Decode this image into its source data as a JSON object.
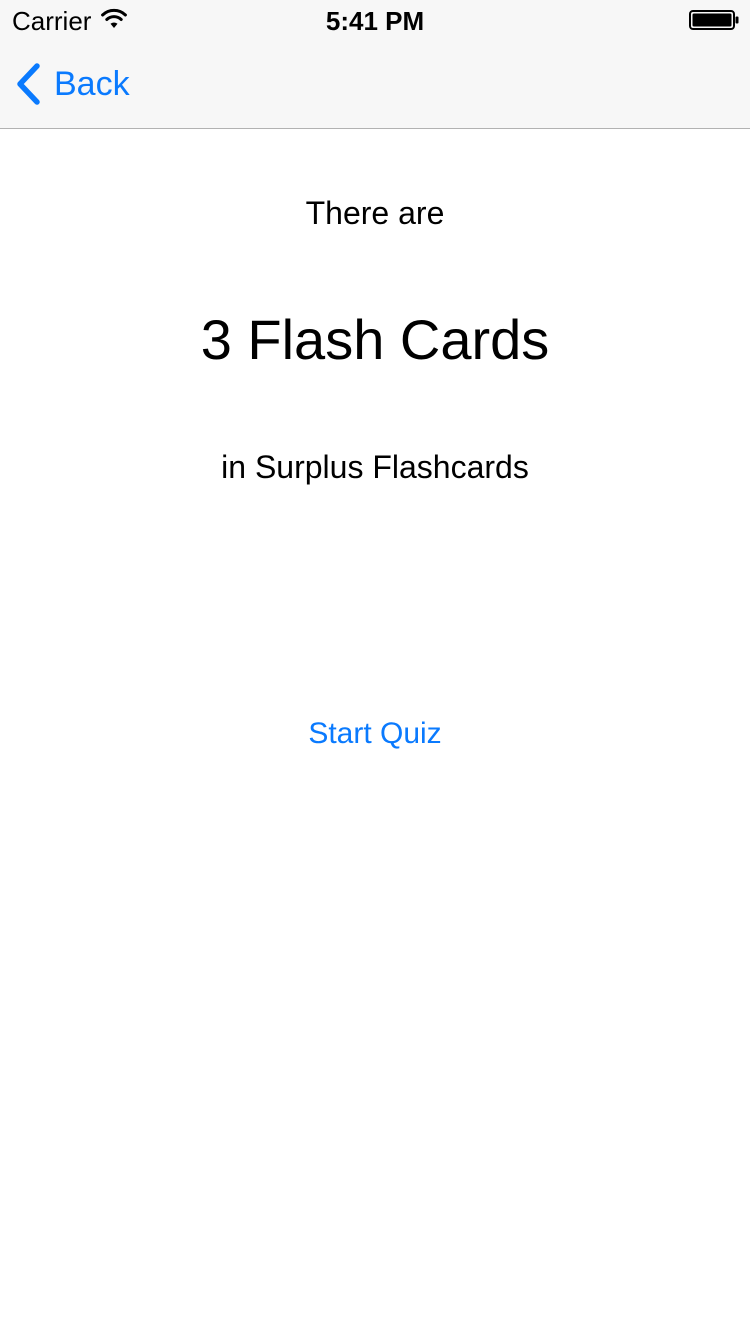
{
  "status_bar": {
    "carrier": "Carrier",
    "time": "5:41 PM",
    "wifi_icon": "wifi-icon",
    "battery_icon": "battery-full-icon"
  },
  "nav_bar": {
    "back_label": "Back",
    "back_icon": "chevron-left-icon"
  },
  "content": {
    "intro": "There are",
    "count_text": "3 Flash Cards",
    "deck_text": "in Surplus Flashcards",
    "start_label": "Start Quiz"
  },
  "colors": {
    "accent": "#0a7afe",
    "bar_background": "#f7f7f7",
    "text": "#000000"
  }
}
